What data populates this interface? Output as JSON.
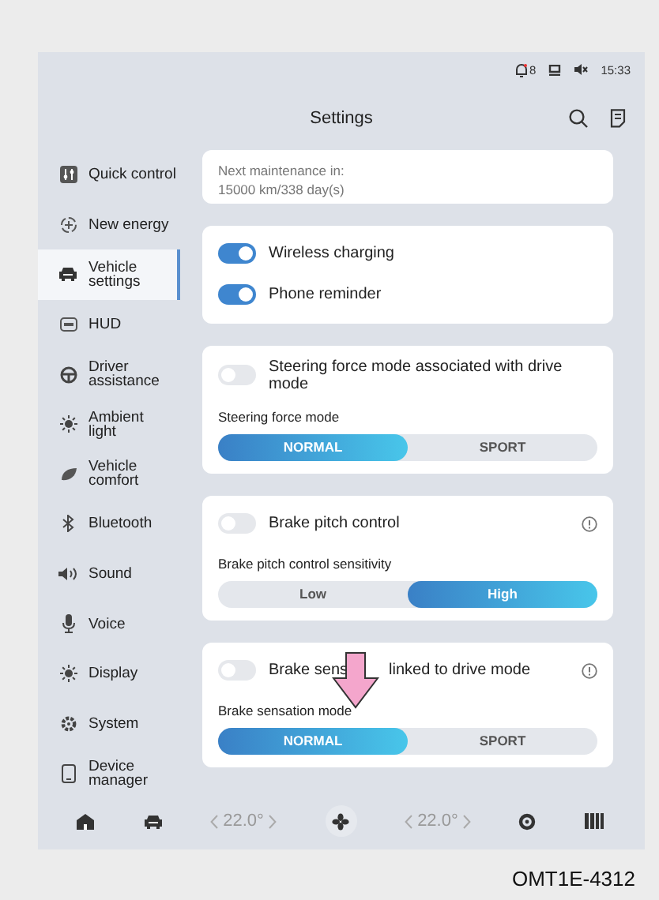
{
  "status_bar": {
    "notification_count": "8",
    "time": "15:33"
  },
  "title": "Settings",
  "sidebar": {
    "items": [
      {
        "label": "Quick control",
        "selected": false
      },
      {
        "label": "New energy",
        "selected": false
      },
      {
        "label": "Vehicle settings",
        "selected": true
      },
      {
        "label": "HUD",
        "selected": false
      },
      {
        "label": "Driver assistance",
        "selected": false
      },
      {
        "label": "Ambient light",
        "selected": false
      },
      {
        "label": "Vehicle comfort",
        "selected": false
      },
      {
        "label": "Bluetooth",
        "selected": false
      },
      {
        "label": "Sound",
        "selected": false
      },
      {
        "label": "Voice",
        "selected": false
      },
      {
        "label": "Display",
        "selected": false
      },
      {
        "label": "System",
        "selected": false
      },
      {
        "label": "Device manager",
        "selected": false
      }
    ]
  },
  "cards": [
    {
      "rows": [
        {
          "kind": "note",
          "lines": [
            "Next maintenance in:",
            "15000 km/338 day(s)"
          ]
        }
      ]
    },
    {
      "rows": [
        {
          "kind": "toggle",
          "label": "Wireless charging",
          "on": true
        },
        {
          "kind": "toggle",
          "label": "Phone reminder",
          "on": true
        }
      ]
    },
    {
      "rows": [
        {
          "kind": "toggle",
          "label": "Steering force mode associated with drive mode",
          "on": false
        },
        {
          "kind": "label",
          "text": "Steering force mode"
        },
        {
          "kind": "segmented",
          "options": [
            {
              "label": "NORMAL",
              "selected": true
            },
            {
              "label": "SPORT",
              "selected": false
            }
          ]
        }
      ]
    },
    {
      "rows": [
        {
          "kind": "toggle",
          "label": "Brake pitch control",
          "on": false,
          "info": true
        },
        {
          "kind": "label",
          "text": "Brake pitch control sensitivity"
        },
        {
          "kind": "segmented",
          "options": [
            {
              "label": "Low",
              "selected": false
            },
            {
              "label": "High",
              "selected": true
            }
          ]
        }
      ]
    },
    {
      "rows": [
        {
          "kind": "toggle",
          "label_parts": [
            "Brake sens",
            "linked to drive mode"
          ],
          "arrow": true,
          "on": false,
          "info": true
        },
        {
          "kind": "label",
          "text": "Brake sensation mode"
        },
        {
          "kind": "segmented",
          "options": [
            {
              "label": "NORMAL",
              "selected": true
            },
            {
              "label": "SPORT",
              "selected": false
            }
          ]
        }
      ]
    }
  ],
  "bottom_bar": {
    "left_temperature": "22.0°",
    "right_temperature": "22.0°"
  },
  "caption": "OMT1E-4312"
}
